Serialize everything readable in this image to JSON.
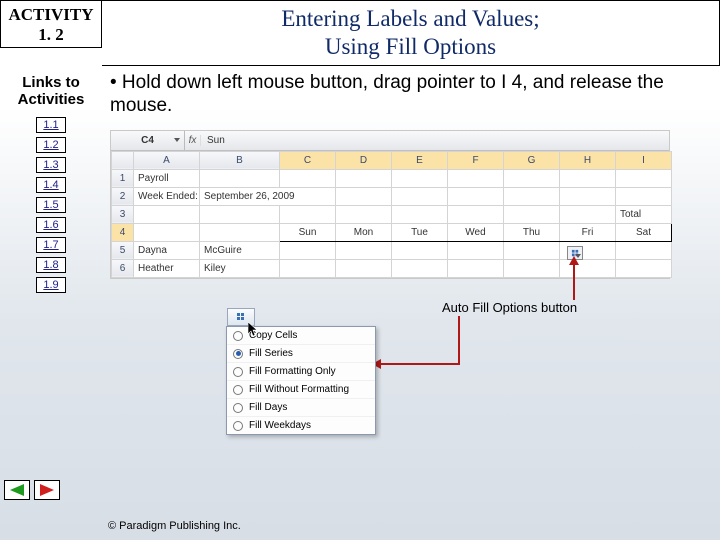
{
  "activity_chip": {
    "label": "ACTIVITY",
    "number": "1. 2"
  },
  "title": {
    "line1": "Entering Labels and Values;",
    "line2": "Using Fill Options"
  },
  "sidebar": {
    "heading": "Links to Activities",
    "links": [
      "1.1",
      "1.2",
      "1.3",
      "1.4",
      "1.5",
      "1.6",
      "1.7",
      "1.8",
      "1.9"
    ]
  },
  "bullet": "• Hold down left mouse button, drag pointer to I 4, and release the mouse.",
  "excel": {
    "name_box": "C4",
    "fx_label": "fx",
    "formula": "Sun",
    "cols": [
      "A",
      "B",
      "C",
      "D",
      "E",
      "F",
      "G",
      "H",
      "I"
    ],
    "rows": [
      {
        "num": "1",
        "cells": [
          "Payroll",
          "",
          "",
          "",
          "",
          "",
          "",
          "",
          ""
        ]
      },
      {
        "num": "2",
        "cells": [
          "Week Ended:",
          "September 26, 2009",
          "",
          "",
          "",
          "",
          "",
          "",
          ""
        ]
      },
      {
        "num": "3",
        "cells": [
          "",
          "",
          "",
          "",
          "",
          "",
          "",
          "",
          "Total"
        ]
      },
      {
        "num": "4",
        "cells": [
          "",
          "",
          "Sun",
          "Mon",
          "Tue",
          "Wed",
          "Thu",
          "Fri",
          "Sat"
        ]
      },
      {
        "num": "5",
        "cells": [
          "Dayna",
          "McGuire",
          "",
          "",
          "",
          "",
          "",
          "",
          ""
        ]
      },
      {
        "num": "6",
        "cells": [
          "Heather",
          "Kiley",
          "",
          "",
          "",
          "",
          "",
          "",
          ""
        ]
      }
    ]
  },
  "autofill_label": "Auto Fill Options button",
  "menu": {
    "items": [
      {
        "label": "Copy Cells",
        "checked": false
      },
      {
        "label": "Fill Series",
        "checked": true
      },
      {
        "label": "Fill Formatting Only",
        "checked": false
      },
      {
        "label": "Fill Without Formatting",
        "checked": false
      },
      {
        "label": "Fill Days",
        "checked": false
      },
      {
        "label": "Fill Weekdays",
        "checked": false
      }
    ]
  },
  "footer": "© Paradigm Publishing Inc."
}
